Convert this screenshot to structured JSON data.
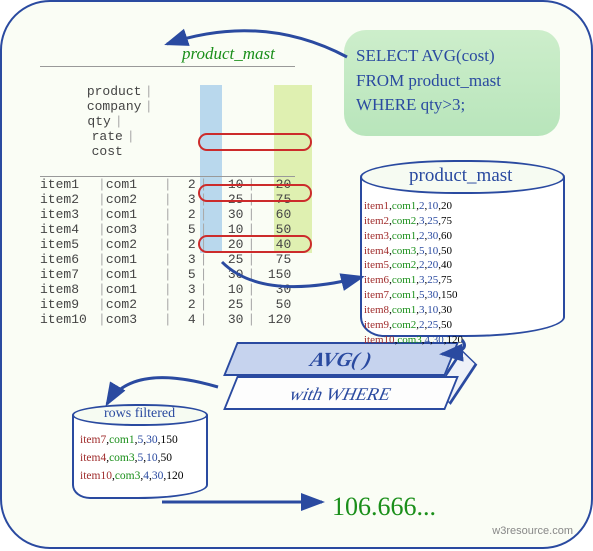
{
  "table": {
    "name": "product_mast",
    "headers": [
      "product",
      "company",
      "qty",
      "rate",
      "cost"
    ],
    "rows": [
      {
        "product": "item1",
        "company": "com1",
        "qty": 2,
        "rate": 10,
        "cost": 20
      },
      {
        "product": "item2",
        "company": "com2",
        "qty": 3,
        "rate": 25,
        "cost": 75
      },
      {
        "product": "item3",
        "company": "com1",
        "qty": 2,
        "rate": 30,
        "cost": 60
      },
      {
        "product": "item4",
        "company": "com3",
        "qty": 5,
        "rate": 10,
        "cost": 50
      },
      {
        "product": "item5",
        "company": "com2",
        "qty": 2,
        "rate": 20,
        "cost": 40
      },
      {
        "product": "item6",
        "company": "com1",
        "qty": 3,
        "rate": 25,
        "cost": 75
      },
      {
        "product": "item7",
        "company": "com1",
        "qty": 5,
        "rate": 30,
        "cost": 150
      },
      {
        "product": "item8",
        "company": "com1",
        "qty": 3,
        "rate": 10,
        "cost": 30
      },
      {
        "product": "item9",
        "company": "com2",
        "qty": 2,
        "rate": 25,
        "cost": 50
      },
      {
        "product": "item10",
        "company": "com3",
        "qty": 4,
        "rate": 30,
        "cost": 120
      }
    ]
  },
  "sql": {
    "line1": "SELECT AVG(cost)",
    "line2": "FROM product_mast",
    "line3": "WHERE qty>3;"
  },
  "cylinder_big": {
    "title": "product_mast",
    "records_left": [
      {
        "item": "item1",
        "com": "com1",
        "a": 2,
        "b": 10,
        "c": 20
      },
      {
        "item": "item2",
        "com": "com2",
        "a": 3,
        "b": 25,
        "c": 75
      },
      {
        "item": "item3",
        "com": "com1",
        "a": 2,
        "b": 30,
        "c": 60
      },
      {
        "item": "item4",
        "com": "com3",
        "a": 5,
        "b": 10,
        "c": 50
      },
      {
        "item": "item5",
        "com": "com2",
        "a": 2,
        "b": 20,
        "c": 40
      }
    ],
    "records_right": [
      {
        "item": "item6",
        "com": "com1",
        "a": 3,
        "b": 25,
        "c": 75
      },
      {
        "item": "item7",
        "com": "com1",
        "a": 5,
        "b": 30,
        "c": 150
      },
      {
        "item": "item8",
        "com": "com1",
        "a": 3,
        "b": 10,
        "c": 30
      },
      {
        "item": "item9",
        "com": "com2",
        "a": 2,
        "b": 25,
        "c": 50
      },
      {
        "item": "item10",
        "com": "com3",
        "a": 4,
        "b": 30,
        "c": 120
      }
    ]
  },
  "func_box": {
    "func": "AVG( )",
    "clause": "with WHERE"
  },
  "cylinder_small": {
    "title": "rows filtered",
    "records": [
      {
        "item": "item7",
        "com": "com1",
        "a": 5,
        "b": 30,
        "c": 150
      },
      {
        "item": "item4",
        "com": "com3",
        "a": 5,
        "b": 10,
        "c": 50
      },
      {
        "item": "item10",
        "com": "com3",
        "a": 4,
        "b": 30,
        "c": 120
      }
    ]
  },
  "result": "106.666...",
  "credit": "w3resource.com"
}
